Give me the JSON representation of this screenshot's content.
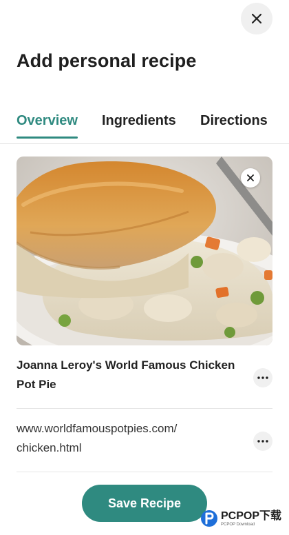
{
  "header": {
    "close_icon": "close-icon",
    "title": "Add personal recipe"
  },
  "tabs": [
    {
      "label": "Overview",
      "active": true
    },
    {
      "label": "Ingredients",
      "active": false
    },
    {
      "label": "Directions",
      "active": false
    }
  ],
  "photo": {
    "description_icon": "recipe-photo",
    "remove_icon": "close-icon"
  },
  "recipe": {
    "title": "Joanna Leroy's World Famous Chicken Pot Pie",
    "url": "www.worldfamouspotpies.com/ chicken.html",
    "more_icon": "more-horizontal-icon"
  },
  "actions": {
    "save_label": "Save Recipe"
  },
  "colors": {
    "accent": "#2f8a80",
    "text": "#1f1f1f",
    "divider": "#e3e3e3"
  },
  "watermark": {
    "brand": "PCPOP下载",
    "sub": "PCPOP Download"
  }
}
